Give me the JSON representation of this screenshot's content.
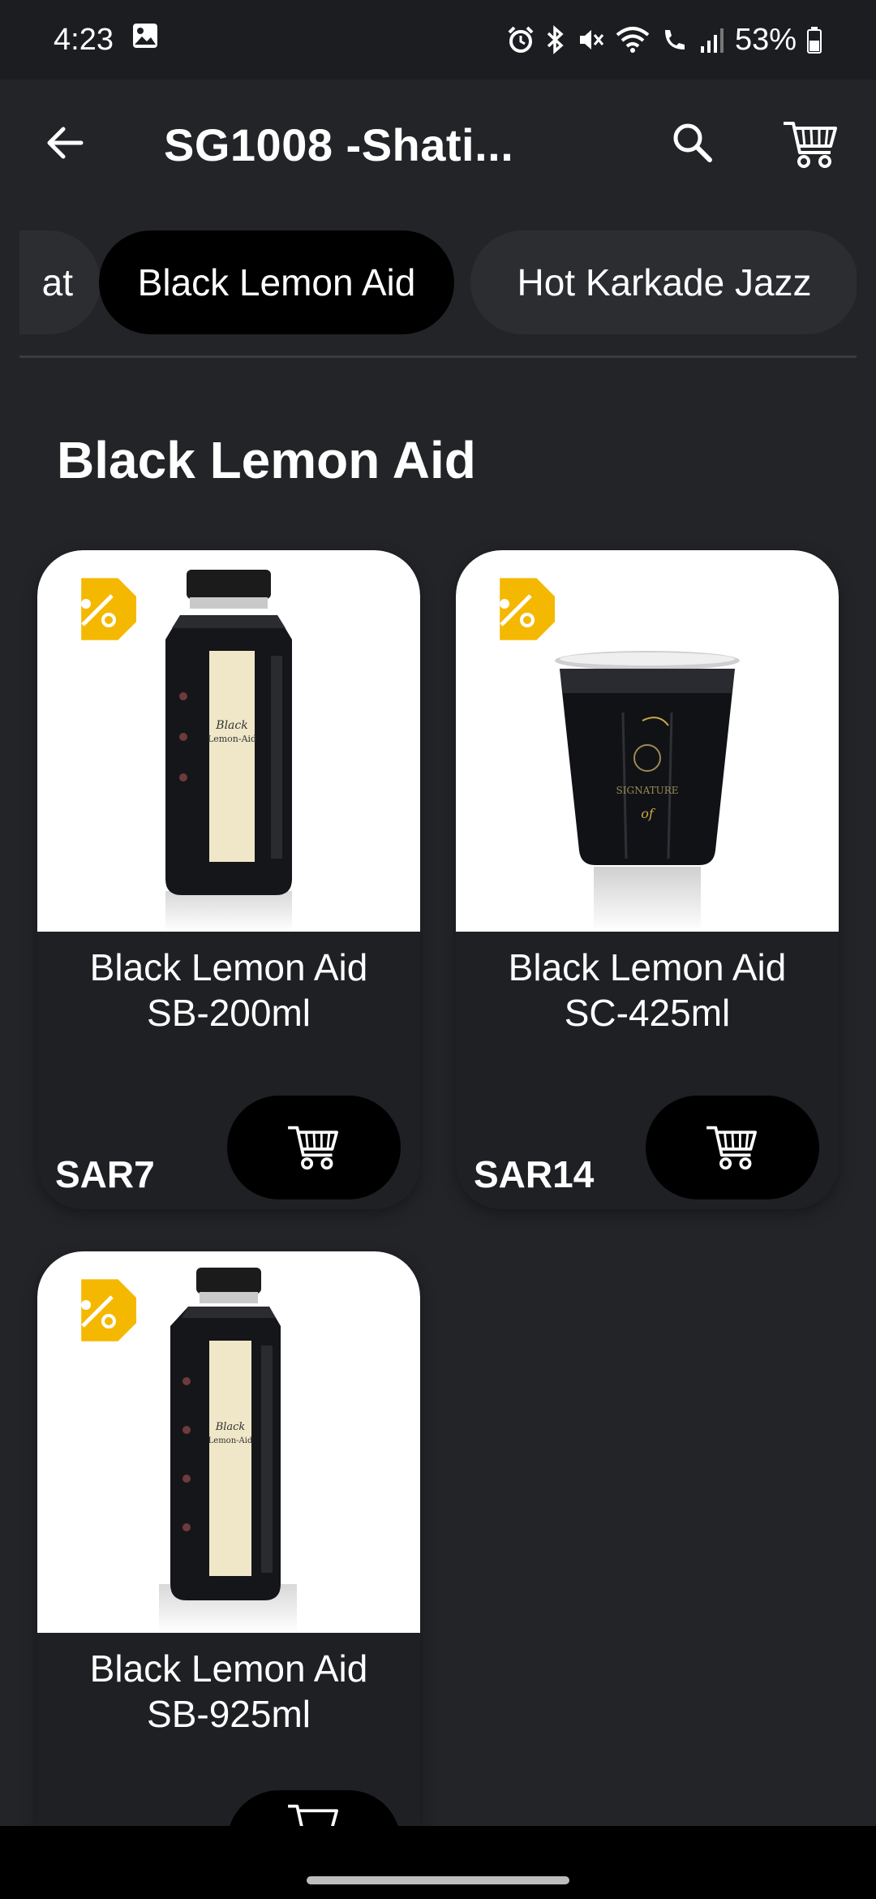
{
  "status_bar": {
    "time": "4:23",
    "battery": "53%"
  },
  "app_bar": {
    "title": "SG1008 -Shati..."
  },
  "categories": [
    {
      "label": "at",
      "active": false
    },
    {
      "label": "Black Lemon Aid",
      "active": true
    },
    {
      "label": "Hot Karkade Jazz",
      "active": false
    }
  ],
  "section": {
    "title": "Black Lemon Aid"
  },
  "products": [
    {
      "name_line1": "Black Lemon Aid",
      "name_line2": "SB-200ml",
      "price": "SAR7",
      "image": "small-bottle"
    },
    {
      "name_line1": "Black Lemon Aid",
      "name_line2": "SC-425ml",
      "price": "SAR14",
      "image": "cup"
    },
    {
      "name_line1": "Black Lemon Aid",
      "name_line2": "SB-925ml",
      "price": "",
      "image": "large-bottle"
    }
  ],
  "colors": {
    "background": "#232428",
    "chip_active": "#000000",
    "chip_inactive": "#2c2d31",
    "discount_tag": "#f5b800"
  },
  "icons": {
    "back": "arrow-left-icon",
    "search": "search-icon",
    "cart": "cart-icon",
    "discount": "discount-tag-icon"
  }
}
